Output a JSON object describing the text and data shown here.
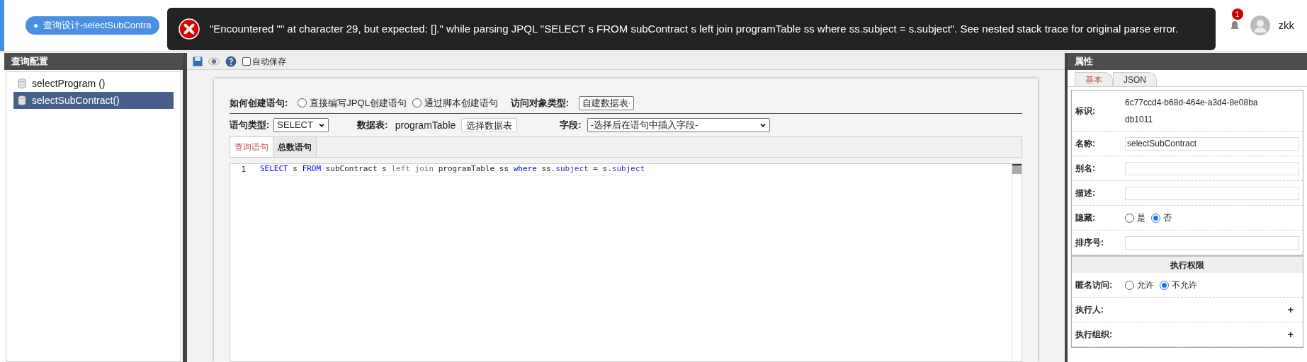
{
  "top_bar": {
    "active_tab": {
      "label": "查询设计-selectSubContra"
    },
    "notification_count": "1",
    "username": "zkk"
  },
  "error_toast": {
    "message": "\"Encountered \"\" at character 29, but expected: [].\" while parsing JPQL \"SELECT s FROM subContract s left join programTable ss where ss.subject = s.subject\". See nested stack trace for original parse error."
  },
  "left_panel": {
    "title": "查询配置",
    "items": [
      {
        "label": "selectProgram ()",
        "selected": false
      },
      {
        "label": "selectSubContract()",
        "selected": true
      }
    ]
  },
  "toolbar": {
    "autosave": {
      "label": "自动保存",
      "checked": false
    }
  },
  "form": {
    "create_method": {
      "label": "如何创建语句:",
      "options": [
        {
          "label": "直接编写JPQL创建语句",
          "selected": false
        },
        {
          "label": "通过脚本创建语句",
          "selected": false
        }
      ]
    },
    "access_type": {
      "label": "访问对象类型:",
      "value": "自建数据表"
    },
    "statement_type": {
      "label": "语句类型:",
      "value": "SELECT"
    },
    "table": {
      "label": "数据表:",
      "value": "programTable",
      "button": "选择数据表"
    },
    "field": {
      "label": "字段:",
      "value": "-选择后在语句中插入字段-"
    }
  },
  "editor_tabs": [
    {
      "label": "查询语句",
      "selected": true
    },
    {
      "label": "总数语句",
      "selected": false
    }
  ],
  "editor": {
    "lines": [
      {
        "number": "1",
        "tokens": [
          {
            "text": "SELECT",
            "kind": "keyword"
          },
          {
            "text": " s ",
            "kind": "plain"
          },
          {
            "text": "FROM",
            "kind": "keyword"
          },
          {
            "text": " subContract s ",
            "kind": "plain"
          },
          {
            "text": "left join",
            "kind": "muted"
          },
          {
            "text": " programTable ss ",
            "kind": "plain"
          },
          {
            "text": "where",
            "kind": "keyword"
          },
          {
            "text": " ss.",
            "kind": "plain"
          },
          {
            "text": "subject",
            "kind": "property"
          },
          {
            "text": " = ",
            "kind": "keyword"
          },
          {
            "text": "s.",
            "kind": "plain"
          },
          {
            "text": "subject",
            "kind": "property"
          }
        ]
      }
    ]
  },
  "right_panel": {
    "title": "属性",
    "tabs": [
      {
        "label": "基本",
        "selected": true
      },
      {
        "label": "JSON",
        "selected": false
      }
    ],
    "rows": [
      {
        "kind": "text",
        "label": "标识:",
        "value": "6c77ccd4-b68d-464e-a3d4-8e08badb1011"
      },
      {
        "kind": "input",
        "label": "名称:",
        "value": "selectSubContract"
      },
      {
        "kind": "input",
        "label": "别名:"
      },
      {
        "kind": "input",
        "label": "描述:"
      },
      {
        "kind": "radio",
        "label": "隐藏:",
        "options": [
          {
            "label": "是",
            "selected": false
          },
          {
            "label": "否",
            "selected": true
          }
        ]
      },
      {
        "kind": "input",
        "label": "排序号:"
      },
      {
        "kind": "section",
        "label": "执行权限"
      },
      {
        "kind": "radio",
        "label": "匿名访问:",
        "options": [
          {
            "label": "允许",
            "selected": false
          },
          {
            "label": "不允许",
            "selected": true
          }
        ]
      },
      {
        "kind": "add",
        "label": "执行人:",
        "action": "+"
      },
      {
        "kind": "add",
        "label": "执行组织:",
        "action": "+"
      }
    ]
  }
}
